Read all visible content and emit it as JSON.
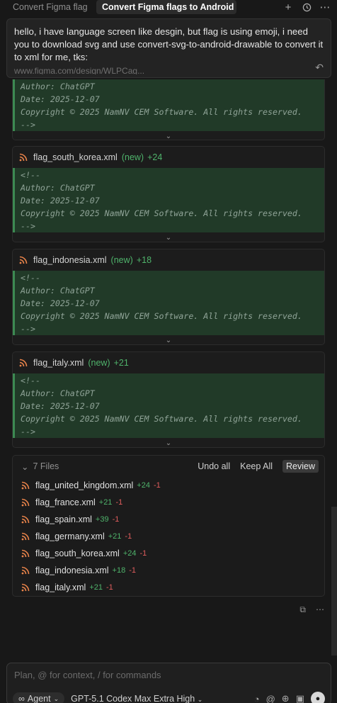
{
  "tabs": [
    {
      "label": "Convert Figma flag",
      "active": false
    },
    {
      "label": "Convert Figma flags to Android",
      "active": true
    }
  ],
  "tab_actions": {
    "new_icon": "plus-icon",
    "history_icon": "clock-icon",
    "more_icon": "ellipsis-icon"
  },
  "prompt": {
    "text": "hello, i have language screen like desgin, but flag is using emoji, i need you to download svg and use convert-svg-to-android-drawable to convert it to xml for me, tks:",
    "link": "www.figma.com/design/WLPCag..."
  },
  "code_comment": {
    "open": "<!--",
    "author": "Author: ChatGPT",
    "date": "Date: 2025-12-07",
    "copyright": "Copyright © 2025 NamNV CEM Software. All rights reserved.",
    "close": "-->"
  },
  "cards": [
    {
      "file": "flag_south_korea.xml",
      "status": "(new)",
      "added": "+24"
    },
    {
      "file": "flag_indonesia.xml",
      "status": "(new)",
      "added": "+18"
    },
    {
      "file": "flag_italy.xml",
      "status": "(new)",
      "added": "+21"
    }
  ],
  "files_panel": {
    "count_label": "7 Files",
    "undo_all": "Undo all",
    "keep_all": "Keep All",
    "review": "Review",
    "files": [
      {
        "name": "flag_united_kingdom.xml",
        "added": "+24",
        "removed": "-1"
      },
      {
        "name": "flag_france.xml",
        "added": "+21",
        "removed": "-1"
      },
      {
        "name": "flag_spain.xml",
        "added": "+39",
        "removed": "-1"
      },
      {
        "name": "flag_germany.xml",
        "added": "+21",
        "removed": "-1"
      },
      {
        "name": "flag_south_korea.xml",
        "added": "+24",
        "removed": "-1"
      },
      {
        "name": "flag_indonesia.xml",
        "added": "+18",
        "removed": "-1"
      },
      {
        "name": "flag_italy.xml",
        "added": "+21",
        "removed": "-1"
      }
    ]
  },
  "composer": {
    "placeholder": "Plan, @ for context, / for commands",
    "mode": "Agent",
    "model": "GPT-5.1 Codex Max Extra High"
  },
  "colors": {
    "accent_green": "#4fb36b",
    "removed_red": "#e05d5d",
    "diff_bg": "#213a28",
    "rss_orange": "#e8834a"
  }
}
